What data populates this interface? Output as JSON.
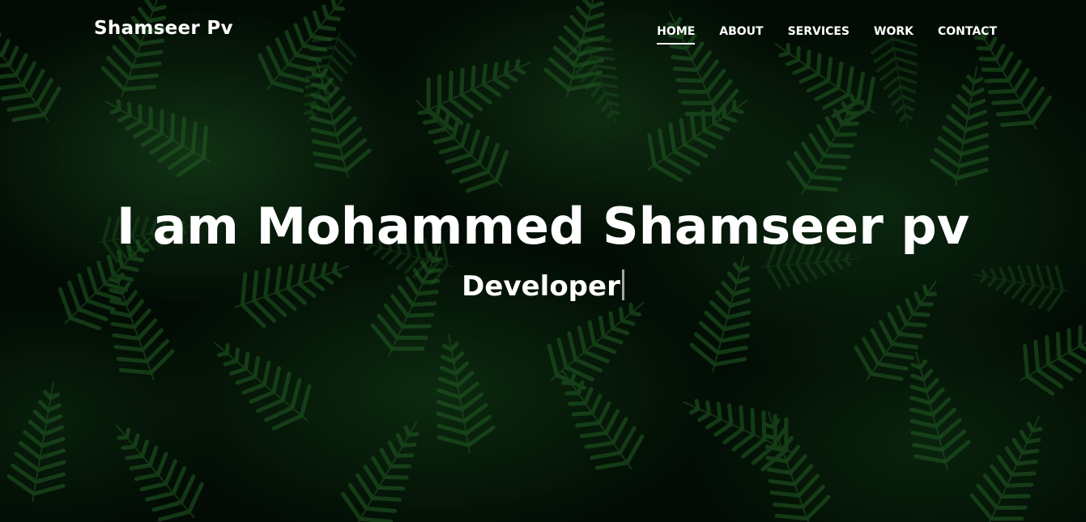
{
  "header": {
    "brand": "Shamseer Pv",
    "nav": [
      {
        "label": "HOME",
        "active": true
      },
      {
        "label": "ABOUT",
        "active": false
      },
      {
        "label": "SERVICES",
        "active": false
      },
      {
        "label": "WORK",
        "active": false
      },
      {
        "label": "CONTACT",
        "active": false
      }
    ]
  },
  "hero": {
    "headline": "I am Mohammed Shamseer pv",
    "typed_text": "Developer",
    "background": "fern-leaves-photo"
  },
  "colors": {
    "text": "#ffffff",
    "background": "#031106",
    "fern": "#1f5a24",
    "cursor": "#a7a7a7"
  }
}
